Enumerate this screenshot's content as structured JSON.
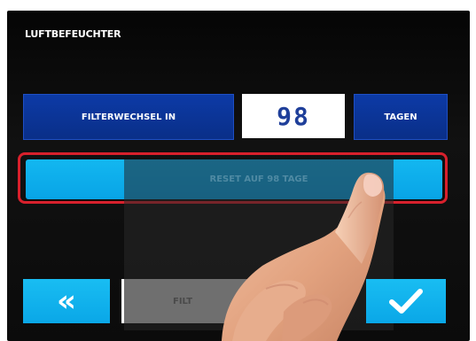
{
  "screen": {
    "title": "LUFTBEFEUCHTER"
  },
  "filter": {
    "label": "FILTERWECHSEL IN",
    "value": "98",
    "unit": "TAGEN"
  },
  "reset": {
    "label": "RESET AUF 98 TAGE"
  },
  "bottom": {
    "back_icon": "double-chevron-left-icon",
    "tab_label_visible": "FILT",
    "confirm_icon": "checkmark-icon"
  },
  "colors": {
    "screen_bg": "#0b0b0b",
    "dark_blue": "#0a2f88",
    "light_blue": "#0aa7e7",
    "highlight_red": "#d8202c"
  }
}
